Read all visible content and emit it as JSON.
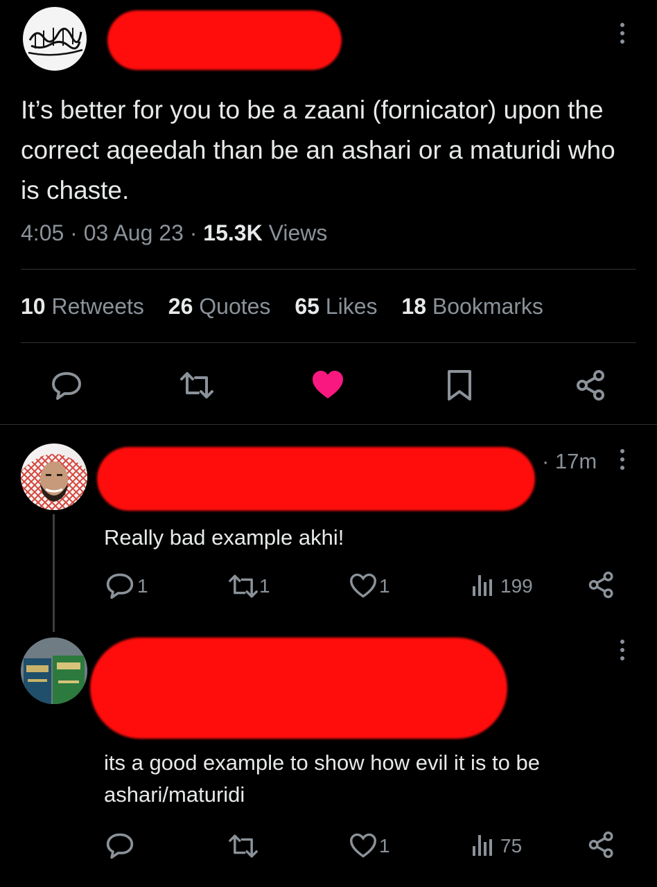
{
  "main_tweet": {
    "avatar_text": "لا إله إلا الله محمد رسول الله",
    "text": "It’s better for you to be a zaani (fornicator) upon the correct aqeedah than be an ashari or a maturidi who is chaste.",
    "time": "4:05",
    "date": "03 Aug 23",
    "views_count": "15.3K",
    "views_label": "Views",
    "sep": "·",
    "stats": [
      {
        "count": "10",
        "label": "Retweets"
      },
      {
        "count": "26",
        "label": "Quotes"
      },
      {
        "count": "65",
        "label": "Likes"
      },
      {
        "count": "18",
        "label": "Bookmarks"
      }
    ]
  },
  "reply1": {
    "time": "· 17m",
    "text": "Really bad example akhi!",
    "replies": "1",
    "retweets": "1",
    "likes": "1",
    "views": "199"
  },
  "reply2": {
    "text": "its a good example to show how evil it is to be ashari/maturidi",
    "likes": "1",
    "views": "75"
  },
  "colors": {
    "background": "#000000",
    "text": "#e7e9ea",
    "muted": "#8b9299",
    "like": "#f91880",
    "redaction": "#ff0d0d"
  }
}
